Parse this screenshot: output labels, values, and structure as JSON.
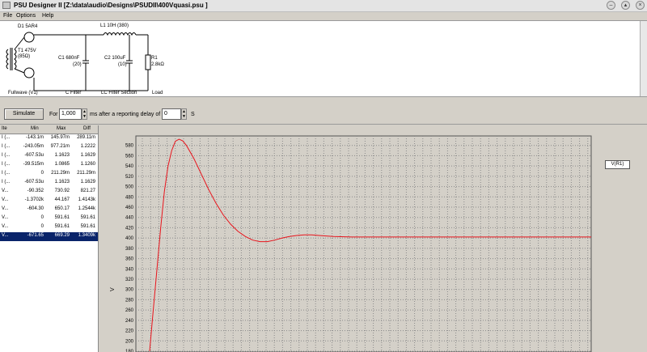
{
  "window": {
    "title": "PSU Designer II  [Z:\\data\\audio\\Designs\\PSUDII\\400Vquasi.psu ]"
  },
  "menu": {
    "file": "File",
    "options": "Options",
    "help": "Help"
  },
  "schematic": {
    "d1_label": "D1 5AR4",
    "t1_label": "T1 475V",
    "t1_ohms": "(85Ω)",
    "l1_label": "L1 10H (380)",
    "c1_label": "C1 680nF",
    "c1_esr": "(20)",
    "c2_label": "C2 100uF",
    "c2_esr": "(10)",
    "r1_label": "R1",
    "r1_value": "2.8kΩ",
    "section_rectifier": "Fullwave (V1)",
    "section_cfilter": "C Filter",
    "section_lc": "LC Filter Section",
    "section_load": "Load"
  },
  "toolbar": {
    "simulate": "Simulate",
    "for_label": "For",
    "duration_value": "1,000",
    "ms_label": "ms after a reporting delay of",
    "delay_value": "0",
    "s_label": "S"
  },
  "zoom": {
    "in": "zoom-in-icon",
    "out": "zoom-out-icon",
    "reset": "zoom-reset-icon"
  },
  "table": {
    "headers": [
      "Ite",
      "Min",
      "Max",
      "Diff"
    ],
    "rows": [
      [
        "I (...",
        "-143.1m",
        "145.97m",
        "289.11m"
      ],
      [
        "I (...",
        "-243.05m",
        "977.21m",
        "1.2222"
      ],
      [
        "I (...",
        "-607.53u",
        "1.1623",
        "1.1629"
      ],
      [
        "I (...",
        "-39.515m",
        "1.0865",
        "1.1260"
      ],
      [
        "I (...",
        "0",
        "211.29m",
        "211.29m"
      ],
      [
        "I (...",
        "-607.53u",
        "1.1623",
        "1.1629"
      ],
      [
        "V...",
        "-90.352",
        "730.92",
        "821.27"
      ],
      [
        "V...",
        "-1.3702k",
        "44.167",
        "1.4143k"
      ],
      [
        "V...",
        "-604.30",
        "650.17",
        "1.2544k"
      ],
      [
        "V...",
        "0",
        "591.61",
        "591.61"
      ],
      [
        "V...",
        "0",
        "591.61",
        "591.61"
      ],
      [
        "V...",
        "-671.65",
        "669.29",
        "1.3409k"
      ]
    ],
    "selected_index": 11
  },
  "legend": {
    "series": "V(R1)"
  },
  "chart_data": {
    "type": "line",
    "ylabel": "V",
    "ylim": [
      180,
      600
    ],
    "yticks": [
      "580",
      "560",
      "540",
      "520",
      "500",
      "480",
      "460",
      "440",
      "420",
      "400",
      "380",
      "360",
      "340",
      "320",
      "300",
      "280",
      "260",
      "240",
      "220",
      "200",
      "180"
    ],
    "grid": true,
    "line_color": "#e8141c",
    "series": [
      {
        "name": "V(R1)",
        "x": [
          0,
          1,
          2,
          3,
          4,
          5,
          6,
          7,
          8,
          9,
          10,
          12,
          14,
          16,
          18,
          20,
          22,
          24,
          26,
          28,
          30,
          32,
          34,
          36,
          38,
          40,
          42,
          44,
          46,
          48,
          50,
          55,
          60,
          70,
          80,
          90,
          100,
          110,
          120
        ],
        "y": [
          180,
          260,
          340,
          420,
          490,
          540,
          570,
          588,
          592,
          589,
          580,
          555,
          525,
          495,
          468,
          445,
          427,
          413,
          403,
          396,
          393,
          393,
          396,
          400,
          403,
          405,
          406,
          406,
          405,
          404,
          403,
          402,
          402,
          402,
          402,
          402,
          402,
          402,
          402
        ]
      }
    ]
  }
}
